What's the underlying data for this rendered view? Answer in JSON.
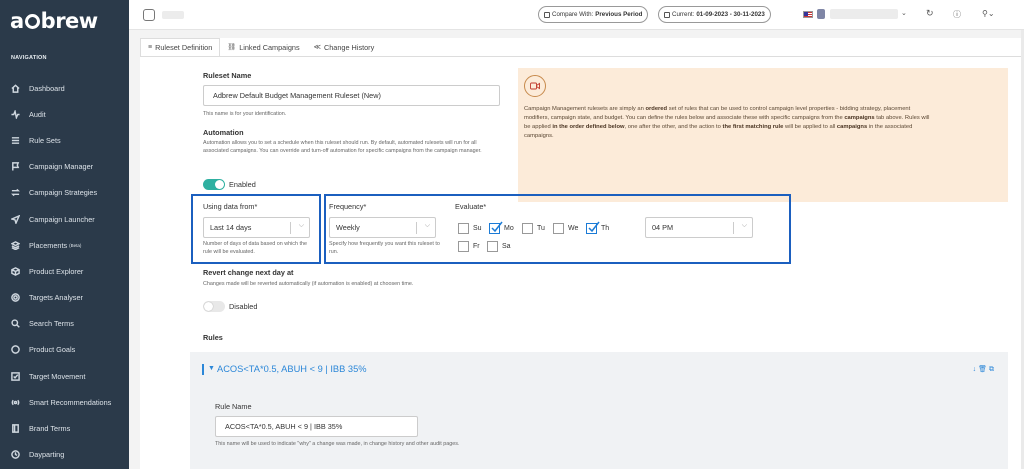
{
  "brand": {
    "logo": "adbrew"
  },
  "sidebar": {
    "heading": "NAVIGATION",
    "items": [
      {
        "label": "Dashboard",
        "icon": "home-icon"
      },
      {
        "label": "Audit",
        "icon": "activity-icon"
      },
      {
        "label": "Rule Sets",
        "icon": "list-icon"
      },
      {
        "label": "Campaign Manager",
        "icon": "flag-icon"
      },
      {
        "label": "Campaign Strategies",
        "icon": "shuffle-icon"
      },
      {
        "label": "Campaign Launcher",
        "icon": "send-icon"
      },
      {
        "label": "Placements",
        "icon": "layers-icon",
        "badge": "(Beta)"
      },
      {
        "label": "Product Explorer",
        "icon": "box-icon"
      },
      {
        "label": "Targets Analyser",
        "icon": "target-icon"
      },
      {
        "label": "Search Terms",
        "icon": "search-icon"
      },
      {
        "label": "Product Goals",
        "icon": "circle-icon"
      },
      {
        "label": "Target Movement",
        "icon": "check-square-icon"
      },
      {
        "label": "Smart Recommendations",
        "icon": "radio-icon"
      },
      {
        "label": "Brand Terms",
        "icon": "book-icon"
      },
      {
        "label": "Dayparting",
        "icon": "clock-icon"
      }
    ]
  },
  "topbar": {
    "compare_label": "Compare With:",
    "compare_value": "Previous Period",
    "current_label": "Current:",
    "current_value": "01-09-2023 - 30-11-2023",
    "account_badge": "5"
  },
  "tabs": [
    {
      "label": "Ruleset Definition",
      "icon": "≡",
      "active": true
    },
    {
      "label": "Linked Campaigns",
      "icon": "🔗",
      "active": false
    },
    {
      "label": "Change History",
      "icon": "≪",
      "active": false
    }
  ],
  "form": {
    "ruleset_name_label": "Ruleset Name",
    "ruleset_name_value": "Adbrew Default Budget Management Ruleset (New)",
    "ruleset_name_help": "This name is for your identification.",
    "automation_label": "Automation",
    "automation_help": "Automation allows you to set a schedule when this ruleset should run. By default, automated rulesets will run for all associated campaigns. You can override and turn-off automation for specific campaigns from the campaign manager.",
    "enabled_label": "Enabled",
    "using_data_label": "Using data from*",
    "using_data_value": "Last 14 days",
    "using_data_help": "Number of days of data based on which the rule will be evaluated.",
    "frequency_label": "Frequency*",
    "frequency_value": "Weekly",
    "frequency_help": "Specify how frequently you want this ruleset to run.",
    "evaluate_label": "Evaluate*",
    "days": [
      {
        "label": "Su",
        "checked": false
      },
      {
        "label": "Mo",
        "checked": true
      },
      {
        "label": "Tu",
        "checked": false
      },
      {
        "label": "We",
        "checked": false
      },
      {
        "label": "Th",
        "checked": true
      },
      {
        "label": "Fr",
        "checked": false
      },
      {
        "label": "Sa",
        "checked": false
      }
    ],
    "time_value": "04 PM",
    "revert_label": "Revert change next day at",
    "revert_help": "Changes made will be reverted automatically (if automation is enabled) at choosen time.",
    "disabled_label": "Disabled",
    "rules_label": "Rules"
  },
  "info": {
    "p1": "Campaign Management rulesets are simply an ",
    "b1": "ordered",
    "p2": " set of rules that can be used to control campaign level properties - bidding strategy, placement modifiers, campaign state, and budget. You can define the rules below and associate these with specific campaigns from the ",
    "b2": "campaigns",
    "p3": " tab above. Rules will be applied ",
    "b3": "in the order defined below",
    "p4": ", one after the other, and the action to ",
    "b4": "the first matching rule",
    "p5": " will be applied to all ",
    "b5": "campaigns",
    "p6": " in the associated campaigns."
  },
  "rule": {
    "title": "ACOS<TA*0.5, ABUH < 9 | IBB 35%",
    "rule_name_label": "Rule Name",
    "rule_name_value": "ACOS<TA*0.5, ABUH < 9 | IBB 35%",
    "rule_name_help": "This name will be used to indicate \"why\" a change was made, in change history and other audit pages."
  },
  "colors": {
    "sidebar": "#2b3a4a",
    "accent": "#2b87d8",
    "highlight": "#1b5fbf",
    "toggle_on": "#2fb0a1",
    "info_bg": "#fcebd9"
  }
}
